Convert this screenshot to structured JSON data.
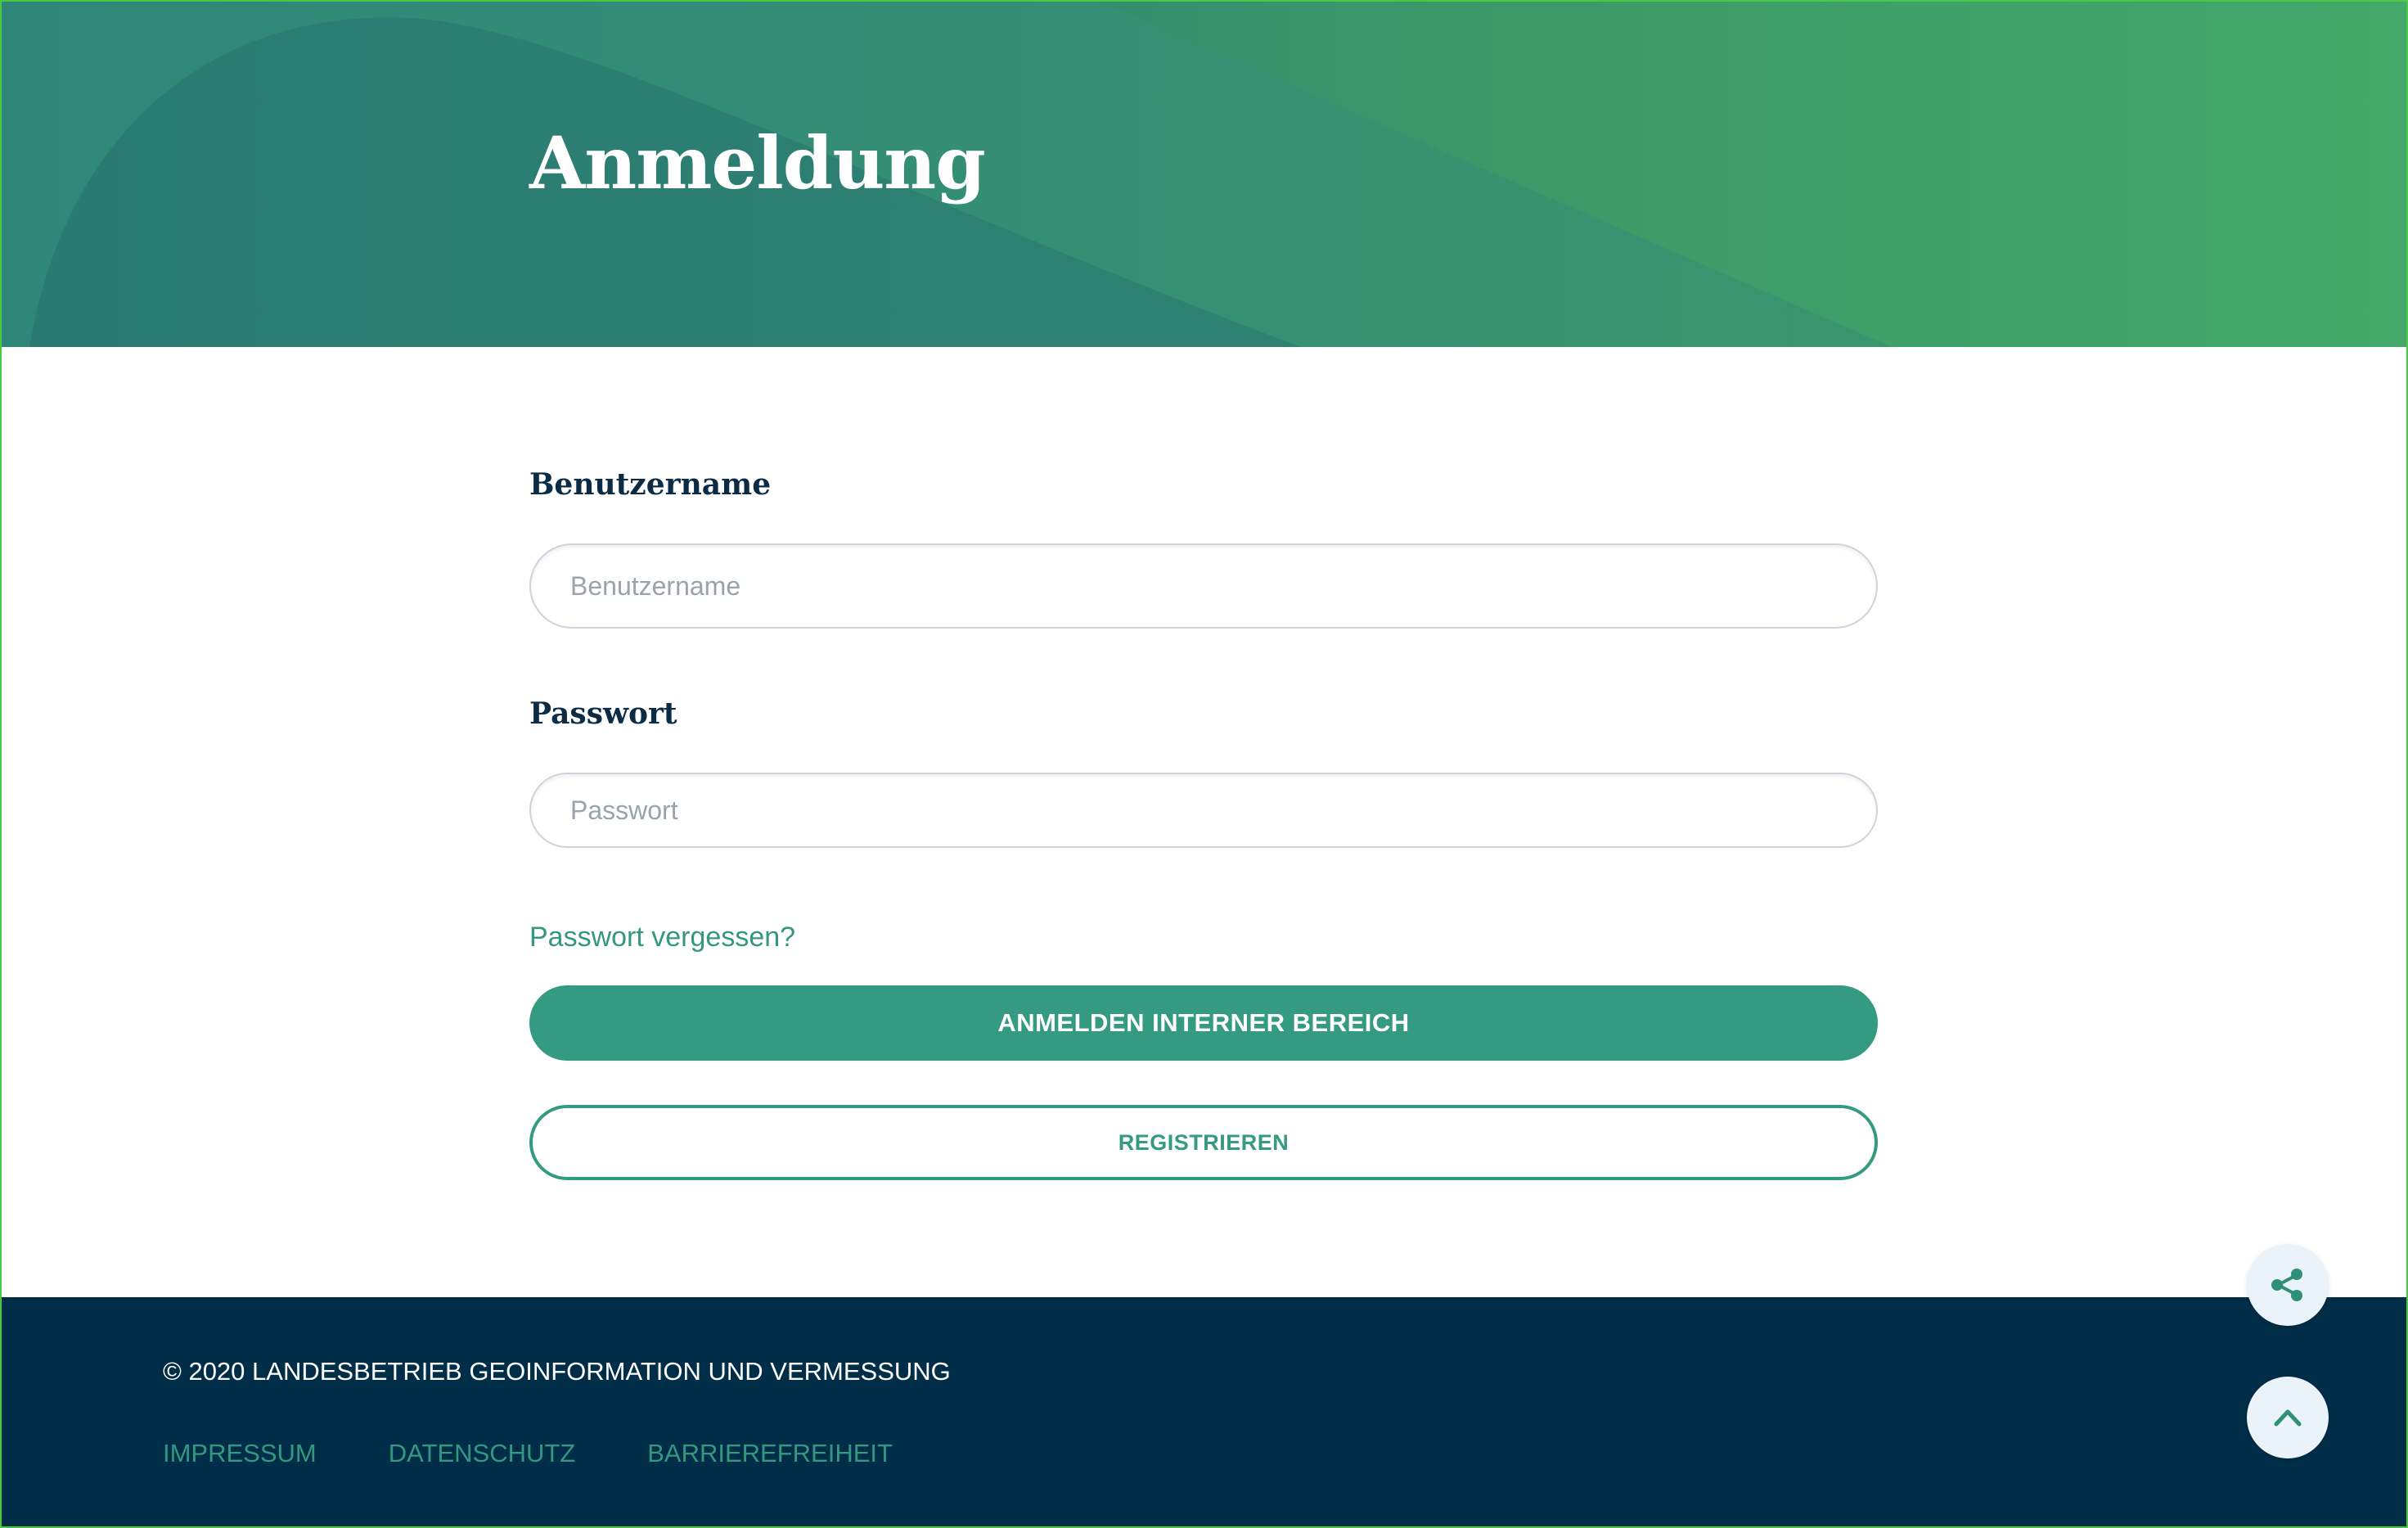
{
  "header": {
    "title": "Anmeldung",
    "gradient_colors": [
      "#2a7d73",
      "#44a86a"
    ]
  },
  "form": {
    "username": {
      "label": "Benutzername",
      "placeholder": "Benutzername",
      "value": ""
    },
    "password": {
      "label": "Passwort",
      "placeholder": "Passwort",
      "value": ""
    },
    "forgot_password": "Passwort vergessen?",
    "login_button": "ANMELDEN INTERNER BEREICH",
    "register_button": "REGISTRIEREN"
  },
  "footer": {
    "copyright": "© 2020 LANDESBETRIEB GEOINFORMATION UND VERMESSUNG",
    "links": [
      "IMPRESSUM",
      "DATENSCHUTZ",
      "BARRIEREFREIHEIT"
    ]
  },
  "floating": {
    "share_icon": "share-icon",
    "scroll_top_icon": "chevron-up-icon"
  },
  "colors": {
    "accent": "#359a82",
    "footer_bg": "#002d48",
    "label_text": "#0c2b45",
    "fab_bg": "#eaf2fa"
  }
}
